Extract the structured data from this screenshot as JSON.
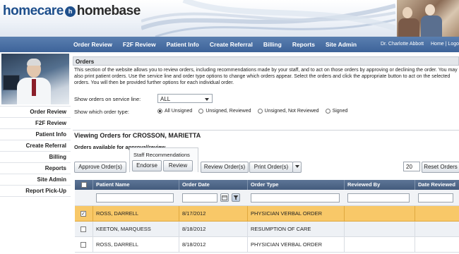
{
  "header": {
    "logo_left": "homecare",
    "logo_mark": "h",
    "logo_right": "homebase"
  },
  "nav": {
    "items": [
      {
        "label": "Order Review"
      },
      {
        "label": "F2F Review"
      },
      {
        "label": "Patient Info"
      },
      {
        "label": "Create Referral"
      },
      {
        "label": "Billing"
      },
      {
        "label": "Reports"
      },
      {
        "label": "Site Admin"
      }
    ],
    "user": "Dr. Charlotte Abbott",
    "home_link": "Home",
    "separator": "|",
    "logout_link": "Logo"
  },
  "sidebar": {
    "items": [
      {
        "label": "Order Review"
      },
      {
        "label": "F2F Review"
      },
      {
        "label": "Patient Info"
      },
      {
        "label": "Create Referral"
      },
      {
        "label": "Billing"
      },
      {
        "label": "Reports"
      },
      {
        "label": "Site Admin"
      },
      {
        "label": "Report Pick-Up"
      }
    ]
  },
  "orders": {
    "title": "Orders",
    "description": "This section of the website allows you to review orders, including recommendations made by your staff, and to act on those orders by approving or declining the order. You may also print patient orders. Use the service line and order type options to change which orders appear. Select the orders and click the appropriate button to act on the selected orders. You will then be provided further options for each individual order.",
    "service_line_label": "Show orders on service line:",
    "service_line_value": "ALL",
    "order_type_label": "Show which order type:",
    "order_types": [
      {
        "label": "All Unsigned",
        "checked": true
      },
      {
        "label": "Unsigned, Reviewed",
        "checked": false
      },
      {
        "label": "Unsigned, Not Reviewed",
        "checked": false
      },
      {
        "label": "Signed",
        "checked": false
      }
    ],
    "viewing_title": "Viewing Orders for CROSSON, MARIETTA",
    "available_label": "Orders available for approval/review",
    "staff_recommendations": "Staff Recommendations",
    "buttons": {
      "approve": "Approve Order(s)",
      "endorse": "Endorse",
      "review": "Review",
      "review_orders": "Review Order(s)",
      "print_orders": "Print Order(s)",
      "reset_orders": "Reset Orders"
    },
    "page_size": "20"
  },
  "grid": {
    "columns": [
      "Patient Name",
      "Order Date",
      "Order Type",
      "Reviewed By",
      "Date Reviewed"
    ],
    "rows": [
      {
        "patient": "ROSS, DARRELL",
        "date": "8/17/2012",
        "type": "PHYSICIAN VERBAL ORDER",
        "reviewed_by": "",
        "date_reviewed": "",
        "checked": true,
        "selected": true
      },
      {
        "patient": "KEETON, MARQUESS",
        "date": "8/18/2012",
        "type": "RESUMPTION OF CARE",
        "reviewed_by": "",
        "date_reviewed": "",
        "checked": false,
        "selected": false
      },
      {
        "patient": "ROSS, DARRELL",
        "date": "8/18/2012",
        "type": "PHYSICIAN VERBAL ORDER",
        "reviewed_by": "",
        "date_reviewed": "",
        "checked": false,
        "selected": false
      }
    ]
  },
  "colors": {
    "nav_bg": "#4a6fa5",
    "grid_header": "#51698b",
    "selected_row": "#f8c868",
    "accent_blue": "#1e4f8c"
  }
}
